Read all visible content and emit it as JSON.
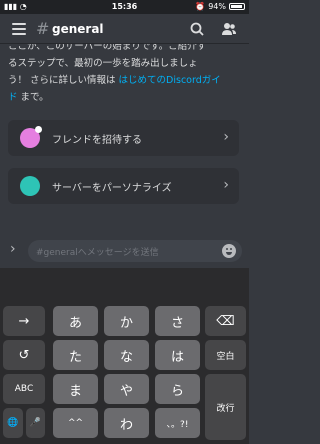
{
  "status": {
    "time": "15:36",
    "battery": "94%"
  },
  "header": {
    "hash": "#",
    "title": "general"
  },
  "intro": {
    "line1": "ここか、このサーバーの始まりです。ご紹介す",
    "line2": "るステップで、最初の一歩を踏み出しましょ",
    "line3_prefix": "う！ さらに詳しい情報は ",
    "line3_link": "はじめてのDiscordガイ",
    "line4_link": "ド",
    "line4_suffix": "まで。"
  },
  "cards": [
    {
      "label": "フレンドを招待する"
    },
    {
      "label": "サーバーをパーソナライズ"
    }
  ],
  "message": {
    "placeholder": "#generalへメッセージを送信"
  },
  "keyboard": {
    "row1": [
      "→",
      "あ",
      "か",
      "さ",
      "⌫"
    ],
    "row2": [
      "↺",
      "た",
      "な",
      "は",
      "空白"
    ],
    "row3": [
      "ABC",
      "ま",
      "や",
      "ら",
      "改行"
    ],
    "row4": [
      "🌐",
      "🎤",
      "^^",
      "わ",
      "、。?!"
    ]
  }
}
